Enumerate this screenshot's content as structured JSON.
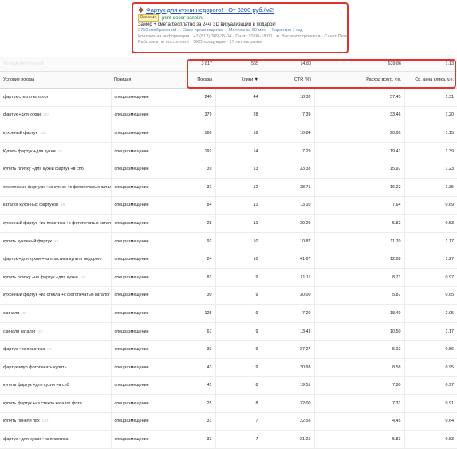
{
  "ad": {
    "title": "Фартук для кухни недорого! - От 3200 руб./м2!",
    "badge": "Реклама",
    "domain": "print-decor-panel.ru",
    "description": "Замер + смета бесплатно за 24ч! 3D визуализация в подарок!",
    "sitelinks": [
      "2750 изображений",
      "Свое производство",
      "Монтаж за 60 мин",
      "Гарантия 1 год"
    ],
    "contact_line1": "Контактная информация · +7 (812) 389-35-04 · Пн-пт 10:00-18:00 · м. Василеостровская · Санкт-Петербург",
    "contact_line2": "Работаем по постоплате · ЭКО-продукция · 17 лет на рынке",
    "colors": {
      "title": "#1b4fbf",
      "domain": "#0f7c2f",
      "frame": "#e0322f"
    }
  },
  "totals": {
    "label": "Условие показа",
    "impressions": "3 817",
    "clicks": "565",
    "ctr": "14.80",
    "spend": "639.86",
    "cpc": "1.13"
  },
  "columns": {
    "query": "Условие показа",
    "position": "Позиция",
    "impressions": "Показы",
    "clicks": "Клики ▼",
    "ctr": "CTR (%)",
    "spend": "Расход всего, у.е.",
    "cpc": "Ср. цена клика, у.е."
  },
  "rows": [
    {
      "q": "фартук стекло каталог",
      "c": "",
      "pos": "спецразмещение",
      "imp": "240",
      "clk": "44",
      "ctr": "18.33",
      "sp": "57.45",
      "cpc": "1.31",
      "g": false
    },
    {
      "q": "фартук +для кухни",
      "c": "304",
      "pos": "спецразмещение",
      "imp": "379",
      "clk": "28",
      "ctr": "7.39",
      "sp": "33.46",
      "cpc": "1.20",
      "g": false
    },
    {
      "q": "кухонный фартук",
      "c": "164",
      "pos": "спецразмещение",
      "imp": "166",
      "clk": "18",
      "ctr": "10.84",
      "sp": "20.66",
      "cpc": "1.15",
      "g": false
    },
    {
      "q": "Купить фартук +для кухни",
      "c": "43",
      "pos": "спецразмещение",
      "imp": "192",
      "clk": "14",
      "ctr": "7.29",
      "sp": "19.41",
      "cpc": "1.39",
      "g": false
    },
    {
      "q": "купить плитку +для кухни фартук +в спб",
      "c": "",
      "pos": "спецразмещение",
      "imp": "39",
      "clk": "13",
      "ctr": "33.33",
      "sp": "15.97",
      "cpc": "1.23",
      "g": false
    },
    {
      "q": "стеклянные фартуки +на кухню +с фотопечатью каталог",
      "c": "",
      "pos": "спецразмещение",
      "imp": "31",
      "clk": "12",
      "ctr": "38.71",
      "sp": "16.22",
      "cpc": "1.35",
      "g": false
    },
    {
      "q": "каталог кухонных фартуков",
      "c": "48",
      "pos": "спецразмещение",
      "imp": "84",
      "clk": "11",
      "ctr": "13.10",
      "sp": "7.64",
      "cpc": "0.69",
      "g": true
    },
    {
      "q": "кухонный фартук +из пластика +с фотопечатью каталог",
      "c": "",
      "pos": "спецразмещение",
      "imp": "28",
      "clk": "11",
      "ctr": "39.29",
      "sp": "5.82",
      "cpc": "0.53",
      "g": true
    },
    {
      "q": "купить кухонный фартук",
      "c": "43",
      "pos": "спецразмещение",
      "imp": "92",
      "clk": "10",
      "ctr": "10.87",
      "sp": "11.70",
      "cpc": "1.17",
      "g": false
    },
    {
      "q": "фартук +для кухни +из пластика купить недорого",
      "c": "",
      "pos": "спецразмещение",
      "imp": "24",
      "clk": "10",
      "ctr": "41.67",
      "sp": "12.68",
      "cpc": "1.27",
      "g": false
    },
    {
      "q": "купить плитку +на фартук +для кухни",
      "c": "18",
      "pos": "спецразмещение",
      "imp": "81",
      "clk": "9",
      "ctr": "11.11",
      "sp": "8.71",
      "cpc": "0.97",
      "g": true
    },
    {
      "q": "кухонный фартук +из стекла +с фотопечатью каталог",
      "c": "",
      "pos": "спецразмещение",
      "imp": "30",
      "clk": "9",
      "ctr": "30.00",
      "sp": "5.87",
      "cpc": "0.65",
      "g": false
    },
    {
      "q": "скинали",
      "c": "88",
      "pos": "спецразмещение",
      "imp": "125",
      "clk": "9",
      "ctr": "7.20",
      "sp": "18.49",
      "cpc": "2.05",
      "g": false
    },
    {
      "q": "скинали каталог",
      "c": "13",
      "pos": "спецразмещение",
      "imp": "67",
      "clk": "9",
      "ctr": "13.43",
      "sp": "10.50",
      "cpc": "1.17",
      "g": false
    },
    {
      "q": "фартук +из пластика",
      "c": "34",
      "pos": "спецразмещение",
      "imp": "33",
      "clk": "9",
      "ctr": "27.27",
      "sp": "5.02",
      "cpc": "0.56",
      "g": false
    },
    {
      "q": "фартук мдф фотопечать купить",
      "c": "",
      "pos": "спецразмещение",
      "imp": "43",
      "clk": "9",
      "ctr": "20.93",
      "sp": "8.58",
      "cpc": "0.95",
      "g": false
    },
    {
      "q": "купить фартук +для кухни +в спб",
      "c": "",
      "pos": "спецразмещение",
      "imp": "41",
      "clk": "8",
      "ctr": "19.51",
      "sp": "7.80",
      "cpc": "0.97",
      "g": false
    },
    {
      "q": "купить фартук +из стекла каталог фото",
      "c": "",
      "pos": "спецразмещение",
      "imp": "25",
      "clk": "8",
      "ctr": "32.00",
      "sp": "7.31",
      "cpc": "0.91",
      "g": false
    },
    {
      "q": "купить панели пвх",
      "c": "144",
      "pos": "спецразмещение",
      "imp": "31",
      "clk": "7",
      "ctr": "22.58",
      "sp": "4.45",
      "cpc": "0.64",
      "g": false
    },
    {
      "q": "фартук +для кухни +из пластика",
      "c": "",
      "pos": "спецразмещение",
      "imp": "33",
      "clk": "7",
      "ctr": "21.21",
      "sp": "5.83",
      "cpc": "0.83",
      "g": false
    }
  ]
}
